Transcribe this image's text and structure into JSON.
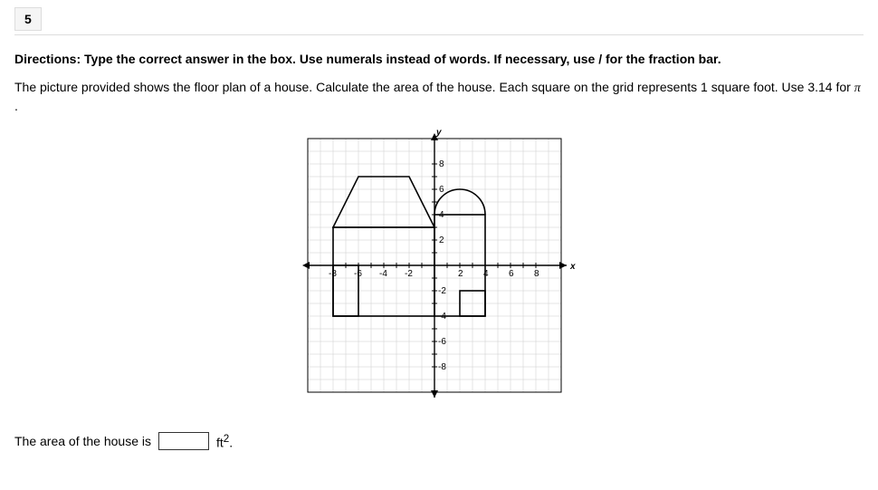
{
  "question_number": "5",
  "directions": "Directions: Type the correct answer in the box. Use numerals instead of words. If necessary, use / for the fraction bar.",
  "problem_line1": "The picture provided shows the floor plan of a house. Calculate the area of the house. Each square on the grid represents 1 square foot. Use 3.14 for ",
  "problem_pi": "π",
  "problem_end": " .",
  "answer_prefix": "The area of the house is",
  "answer_unit_pre": "ft",
  "answer_unit_sup": "2",
  "answer_unit_post": ".",
  "answer_value": "",
  "axes": {
    "x_label": "x",
    "y_label": "y",
    "x_ticks": [
      -8,
      -6,
      -4,
      -2,
      2,
      4,
      6,
      8
    ],
    "y_ticks": [
      8,
      6,
      4,
      2,
      -2,
      -4,
      -6,
      -8
    ]
  },
  "chart_data": {
    "type": "diagram",
    "title": "House floor plan on coordinate grid",
    "grid_unit": "1 square foot",
    "xlim": [
      -10,
      10
    ],
    "ylim": [
      -10,
      10
    ],
    "shapes": [
      {
        "name": "main-body-rectangle",
        "type": "polygon",
        "points": [
          [
            -8,
            3
          ],
          [
            0,
            3
          ],
          [
            0,
            -4
          ],
          [
            -8,
            -4
          ]
        ]
      },
      {
        "name": "left-roof-trapezoid",
        "type": "polygon",
        "points": [
          [
            -8,
            3
          ],
          [
            -6,
            7
          ],
          [
            -2,
            7
          ],
          [
            0,
            3
          ]
        ]
      },
      {
        "name": "left-bottom-notch-cutout",
        "type": "polygon",
        "points": [
          [
            -8,
            0
          ],
          [
            -6,
            0
          ],
          [
            -6,
            -4
          ],
          [
            -8,
            -4
          ]
        ]
      },
      {
        "name": "right-body-rectangle",
        "type": "polygon",
        "points": [
          [
            0,
            4
          ],
          [
            4,
            4
          ],
          [
            4,
            -4
          ],
          [
            0,
            -4
          ]
        ]
      },
      {
        "name": "right-roof-semicircle",
        "type": "arc",
        "center": [
          2,
          4
        ],
        "radius": 2,
        "start_angle": 0,
        "end_angle": 180
      },
      {
        "name": "right-bottom-notch-cutout",
        "type": "polygon",
        "points": [
          [
            2,
            -2
          ],
          [
            4,
            -2
          ],
          [
            4,
            -4
          ],
          [
            2,
            -4
          ]
        ]
      }
    ]
  }
}
